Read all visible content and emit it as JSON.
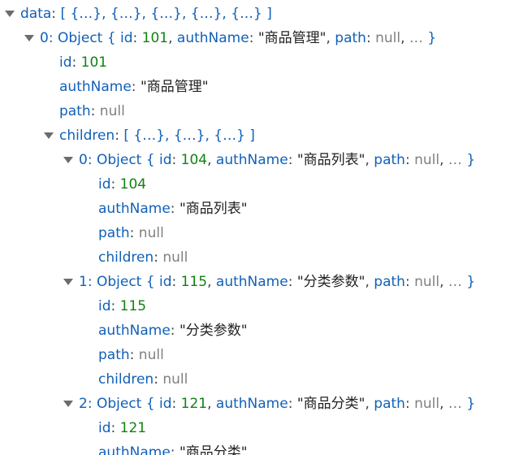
{
  "data_row": {
    "key": "data",
    "preview": "[ {…}, {…}, {…}, {…}, {…} ]"
  },
  "item0": {
    "index": "0",
    "type": "Object",
    "id_key": "id",
    "id": "101",
    "auth_key": "authName",
    "authName": "\"商品管理\"",
    "path_key": "path",
    "path": "null",
    "ellipsis": "…",
    "fields": {
      "id_key": "id",
      "id": "101",
      "auth_key": "authName",
      "authName": "\"商品管理\"",
      "path_key": "path",
      "path": "null"
    },
    "children_key": "children",
    "children_preview": "[ {…}, {…}, {…} ]"
  },
  "children": [
    {
      "index": "0",
      "type": "Object",
      "id": "104",
      "authName": "\"商品列表\"",
      "path": "null",
      "children": "null"
    },
    {
      "index": "1",
      "type": "Object",
      "id": "115",
      "authName": "\"分类参数\"",
      "path": "null",
      "children": "null"
    },
    {
      "index": "2",
      "type": "Object",
      "id": "121",
      "authName": "\"商品分类\""
    }
  ],
  "keys": {
    "id": "id",
    "authName": "authName",
    "path": "path",
    "children": "children"
  },
  "punct": {
    "colon": ":",
    "brace_open": "{",
    "brace_close": "}",
    "comma": ",",
    "ellipsis": "…"
  },
  "colors": {
    "key": "#1160b8",
    "number": "#118311",
    "string": "#222222",
    "null": "#808080",
    "twisty": "#6c6c6c"
  },
  "icons": {
    "twisty": "triangle-down-icon"
  }
}
